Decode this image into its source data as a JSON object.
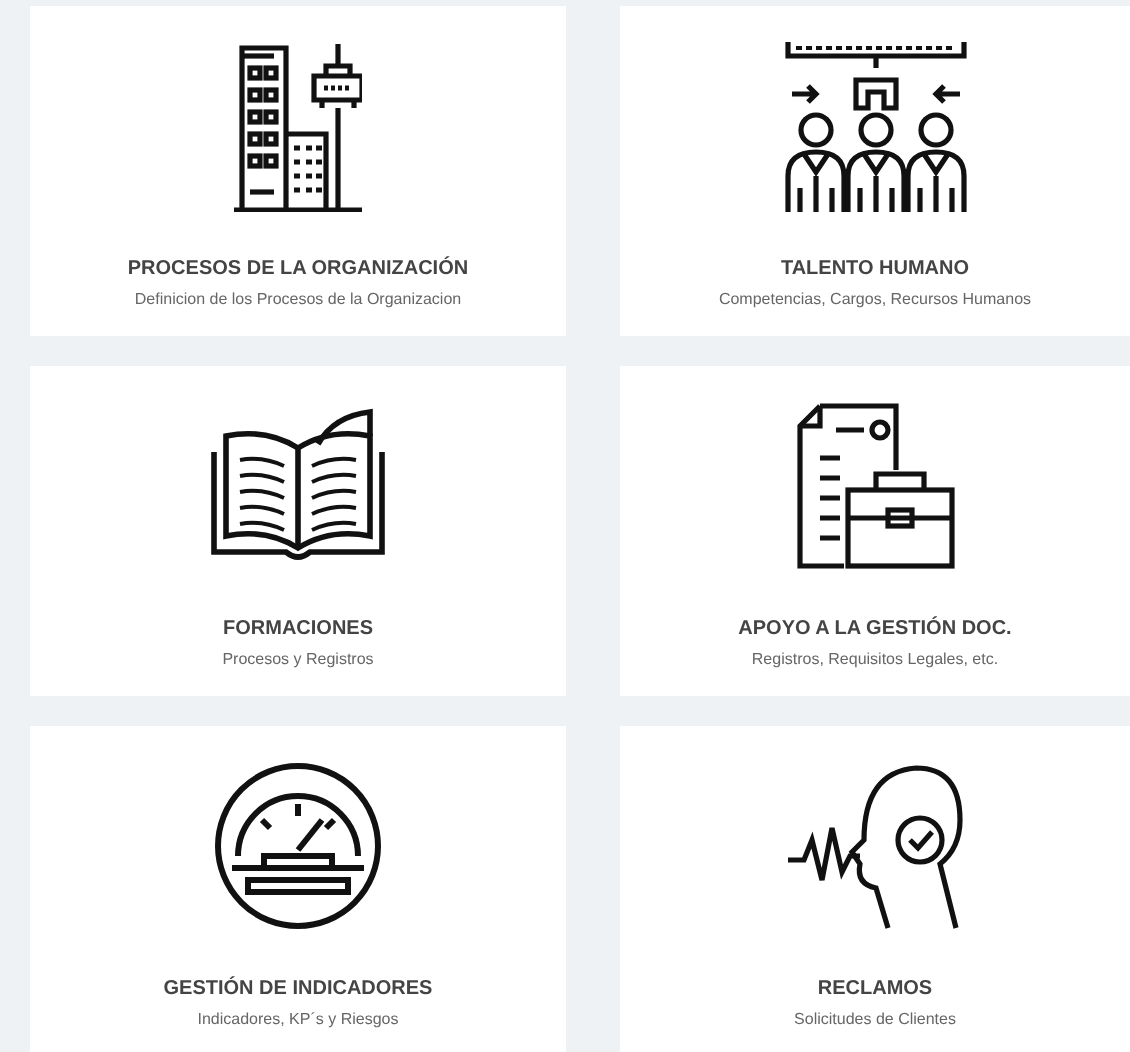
{
  "tiles": [
    {
      "kind": "buildings",
      "title": "PROCESOS DE LA ORGANIZACIÓN",
      "subtitle": "Definicion de los Procesos de la Organizacion"
    },
    {
      "kind": "team",
      "title": "TALENTO HUMANO",
      "subtitle": "Competencias, Cargos, Recursos Humanos"
    },
    {
      "kind": "book",
      "title": "FORMACIONES",
      "subtitle": "Procesos y Registros"
    },
    {
      "kind": "documents",
      "title": "APOYO A LA GESTIÓN DOC.",
      "subtitle": "Registros, Requisitos Legales, etc."
    },
    {
      "kind": "gauge",
      "title": "GESTIÓN DE INDICADORES",
      "subtitle": "Indicadores, KP´s y Riesgos"
    },
    {
      "kind": "voice",
      "title": "RECLAMOS",
      "subtitle": "Solicitudes de Clientes"
    }
  ]
}
